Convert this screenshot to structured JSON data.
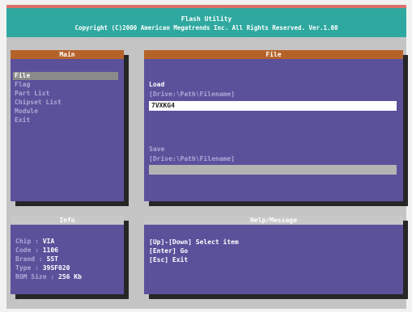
{
  "title": {
    "line1": "Flash Utility",
    "line2": "Copyright (C)2000 American Megatrends Inc. All Rights Reserved. Ver.1.00"
  },
  "main": {
    "header": "Main",
    "items": [
      "File",
      "Flag",
      "Part List",
      "Chipset List",
      "Module",
      "Exit"
    ],
    "selected": "File"
  },
  "file": {
    "header": "File",
    "load_label": "Load",
    "load_hint": "[Drive:\\Path\\Filename]",
    "load_value": "7VXKG4",
    "save_label": "Save",
    "save_hint": "[Drive:\\Path\\Filename]",
    "save_value": ""
  },
  "info": {
    "header": "Info",
    "rows": [
      {
        "label": "Chip   :",
        "value": "VIA"
      },
      {
        "label": "Code   :",
        "value": "1106"
      },
      {
        "label": "Brand  :",
        "value": "SST"
      },
      {
        "label": "Type   :",
        "value": "39SF020"
      },
      {
        "label": "ROM Size :",
        "value": "256 Kb"
      }
    ]
  },
  "help": {
    "header": "Help/Message",
    "lines": [
      "[Up]-[Down] Select item",
      "[Enter] Go",
      "[Esc] Exit"
    ]
  },
  "colors": {
    "title_bg": "#2fa9a0",
    "title_top_line": "#d9726b",
    "panel_bg": "#5b519b",
    "panel_header_orange": "#b5622a",
    "panel_header_gray": "#c8c8c8"
  }
}
